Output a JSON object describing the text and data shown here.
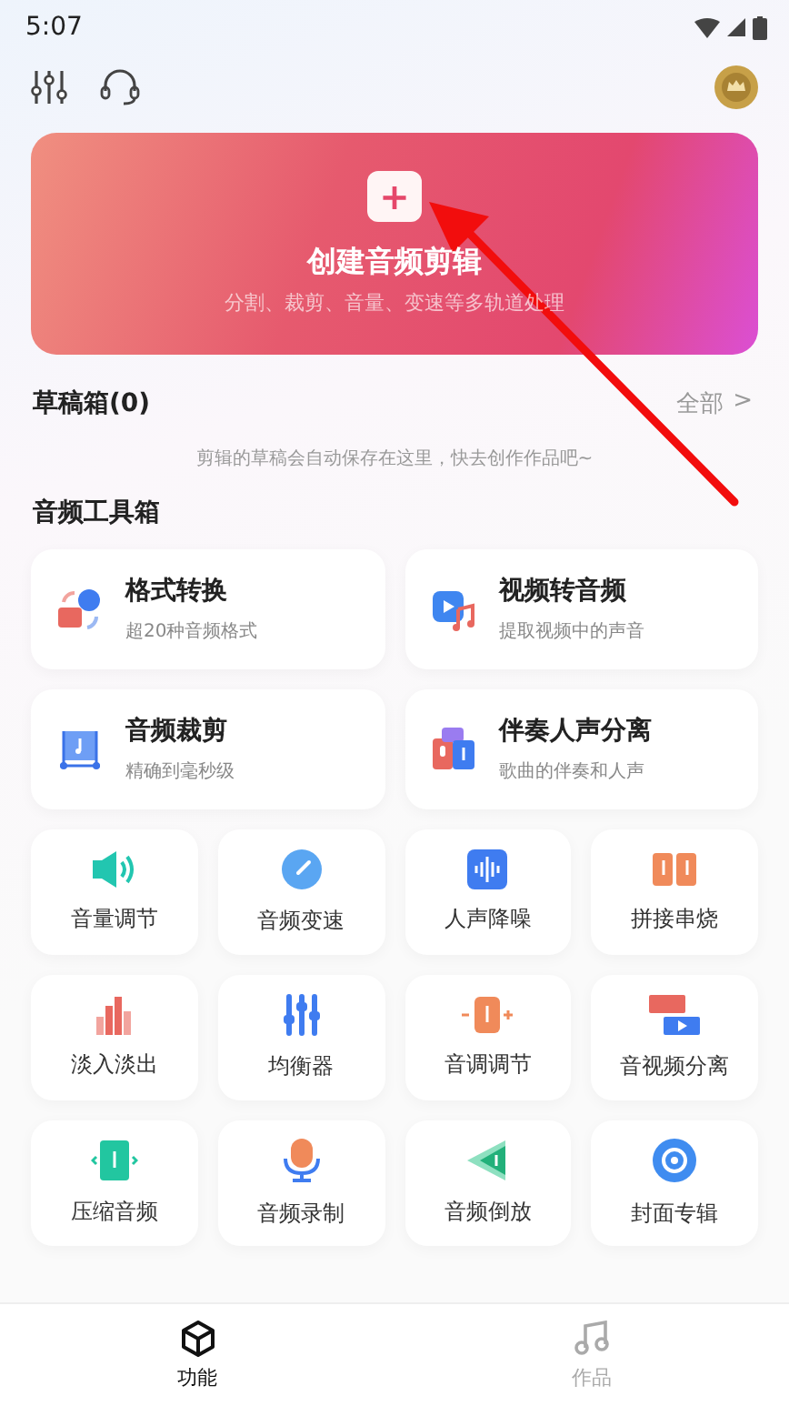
{
  "status_bar": {
    "time": "5:07"
  },
  "banner": {
    "icon_text": "+",
    "title": "创建音频剪辑",
    "subtitle": "分割、裁剪、音量、变速等多轨道处理"
  },
  "drafts": {
    "title": "草稿箱(0)",
    "link": "全部",
    "link_chevron": ">",
    "empty_hint": "剪辑的草稿会自动保存在这里，快去创作作品吧~"
  },
  "toolbox": {
    "title": "音频工具箱",
    "big_tools": [
      {
        "title": "格式转换",
        "subtitle": "超20种音频格式"
      },
      {
        "title": "视频转音频",
        "subtitle": "提取视频中的声音"
      },
      {
        "title": "音频裁剪",
        "subtitle": "精确到毫秒级"
      },
      {
        "title": "伴奏人声分离",
        "subtitle": "歌曲的伴奏和人声"
      }
    ],
    "small_tools": [
      {
        "label": "音量调节"
      },
      {
        "label": "音频变速"
      },
      {
        "label": "人声降噪"
      },
      {
        "label": "拼接串烧"
      },
      {
        "label": "淡入淡出"
      },
      {
        "label": "均衡器"
      },
      {
        "label": "音调调节"
      },
      {
        "label": "音视频分离"
      },
      {
        "label": "压缩音频"
      },
      {
        "label": "音频录制"
      },
      {
        "label": "音频倒放"
      },
      {
        "label": "封面专辑"
      }
    ]
  },
  "bottom_nav": [
    {
      "label": "功能",
      "selected": true
    },
    {
      "label": "作品",
      "selected": false
    }
  ]
}
